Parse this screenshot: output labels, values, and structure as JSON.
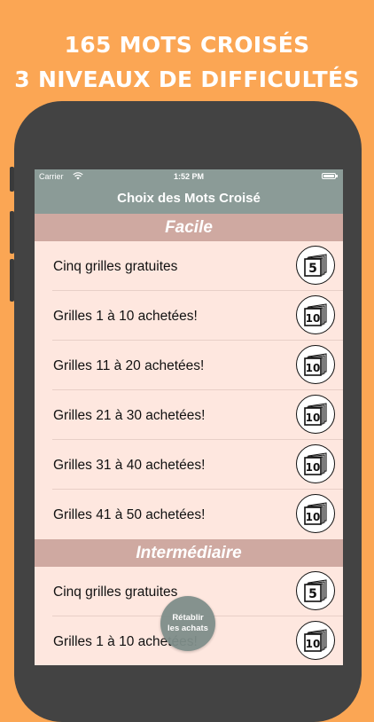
{
  "promo": {
    "line1": "165 MOTS CROISÉS",
    "line2": "3 NIVEAUX DE DIFFICULTÉS"
  },
  "status_bar": {
    "carrier": "Carrier",
    "time": "1:52 PM"
  },
  "nav": {
    "title": "Choix des Mots Croisé"
  },
  "sections": [
    {
      "title": "Facile",
      "rows": [
        {
          "label": "Cinq grilles gratuites",
          "badge": "5"
        },
        {
          "label": "Grilles 1 à 10 achetées!",
          "badge": "10"
        },
        {
          "label": "Grilles 11 à 20 achetées!",
          "badge": "10"
        },
        {
          "label": "Grilles 21 à 30 achetées!",
          "badge": "10"
        },
        {
          "label": "Grilles 31 à 40 achetées!",
          "badge": "10"
        },
        {
          "label": "Grilles 41 à 50 achetées!",
          "badge": "10"
        }
      ]
    },
    {
      "title": "Intermédiaire",
      "rows": [
        {
          "label": "Cinq grilles gratuites",
          "badge": "5"
        },
        {
          "label": "Grilles 1 à 10 achetées!",
          "badge": "10"
        }
      ]
    }
  ],
  "restore": {
    "line1": "Rétablir",
    "line2": "les achats"
  },
  "colors": {
    "background": "#fba654",
    "navbar": "#8b9b97",
    "section_header": "#cfa9a1",
    "row_background": "#fee7df",
    "restore_button": "#7f8e8a"
  }
}
